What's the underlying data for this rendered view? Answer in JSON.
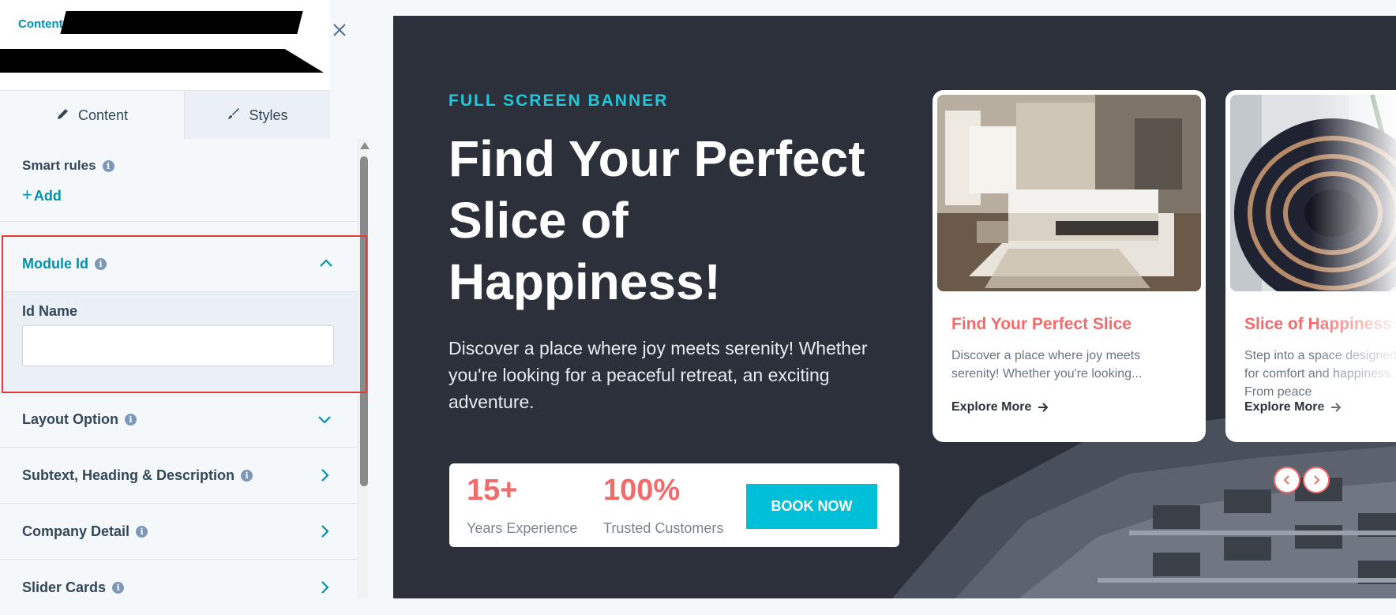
{
  "sidebar": {
    "breadcrumb": "Contents",
    "tabs": [
      {
        "label": "Content",
        "icon": "pencil-icon"
      },
      {
        "label": "Styles",
        "icon": "brush-icon"
      }
    ],
    "smart_rules": {
      "label": "Smart rules",
      "add_label": "Add"
    },
    "module_id": {
      "label": "Module Id",
      "id_name_label": "Id Name",
      "id_name_value": ""
    },
    "sections": [
      {
        "label": "Layout Option"
      },
      {
        "label": "Subtext, Heading & Description"
      },
      {
        "label": "Company Detail"
      },
      {
        "label": "Slider Cards"
      }
    ]
  },
  "preview": {
    "kicker": "FULL SCREEN BANNER",
    "headline": "Find Your Perfect Slice of Happiness!",
    "description": "Discover a place where joy meets serenity! Whether you're looking for a peaceful retreat, an exciting adventure.",
    "stats": [
      {
        "value": "15+",
        "label": "Years Experience"
      },
      {
        "value": "100%",
        "label": "Trusted Customers"
      }
    ],
    "book_button": "BOOK NOW",
    "cards": [
      {
        "title": "Find Your Perfect Slice",
        "text": "Discover a place where joy meets serenity! Whether you're looking...",
        "link": "Explore More"
      },
      {
        "title": "Slice of Happiness",
        "text": "Step into a space designed for comfort and happiness. From peace",
        "link": "Explore More"
      }
    ],
    "colors": {
      "accent": "#26c6da",
      "coral": "#f26b6b",
      "dark": "#2b303b",
      "button": "#00c0d9"
    }
  }
}
